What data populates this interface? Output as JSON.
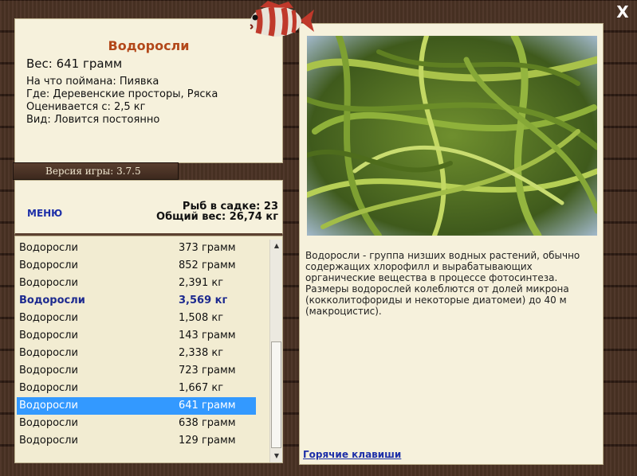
{
  "fish": {
    "title": "Водоросли",
    "weight": "Вес: 641 грамм",
    "caught_on": "На что поймана: Пиявка",
    "where": "Где: Деревенские просторы, Ряска",
    "valued_from": "Оценивается с: 2,5 кг",
    "kind": "Вид: Ловится постоянно"
  },
  "version": "Версия игры: 3.7.5",
  "menu_label": "МЕНЮ",
  "stats": {
    "fish_in_keepnet": "Рыб в садке: 23",
    "total_weight": "Общий вес: 26,74 кг"
  },
  "catch_list": [
    {
      "name": "Водоросли",
      "weight": "373 грамм"
    },
    {
      "name": "Водоросли",
      "weight": "852 грамм"
    },
    {
      "name": "Водоросли",
      "weight": "2,391 кг"
    },
    {
      "name": "Водоросли",
      "weight": "3,569 кг"
    },
    {
      "name": "Водоросли",
      "weight": "1,508 кг"
    },
    {
      "name": "Водоросли",
      "weight": "143 грамм"
    },
    {
      "name": "Водоросли",
      "weight": "2,338 кг"
    },
    {
      "name": "Водоросли",
      "weight": "723 грамм"
    },
    {
      "name": "Водоросли",
      "weight": "1,667 кг"
    },
    {
      "name": "Водоросли",
      "weight": "641 грамм"
    },
    {
      "name": "Водоросли",
      "weight": "638 грамм"
    },
    {
      "name": "Водоросли",
      "weight": "129 грамм"
    }
  ],
  "description": "Водоросли - группа низших водных растений, обычно содержащих хлорофилл и вырабатывающих органические вещества в процессе фотосинтеза. Размеры водорослей колеблются от долей микрона (кокколитофориды и некоторые диатомеи) до 40 м (макроцистис).",
  "hotkeys_label": "Горячие клавиши",
  "close_label": "X",
  "colors": {
    "title": "#b3481a",
    "link": "#1d2fa8",
    "selected_row": "#3399ff",
    "panel": "#f6f1dc"
  }
}
